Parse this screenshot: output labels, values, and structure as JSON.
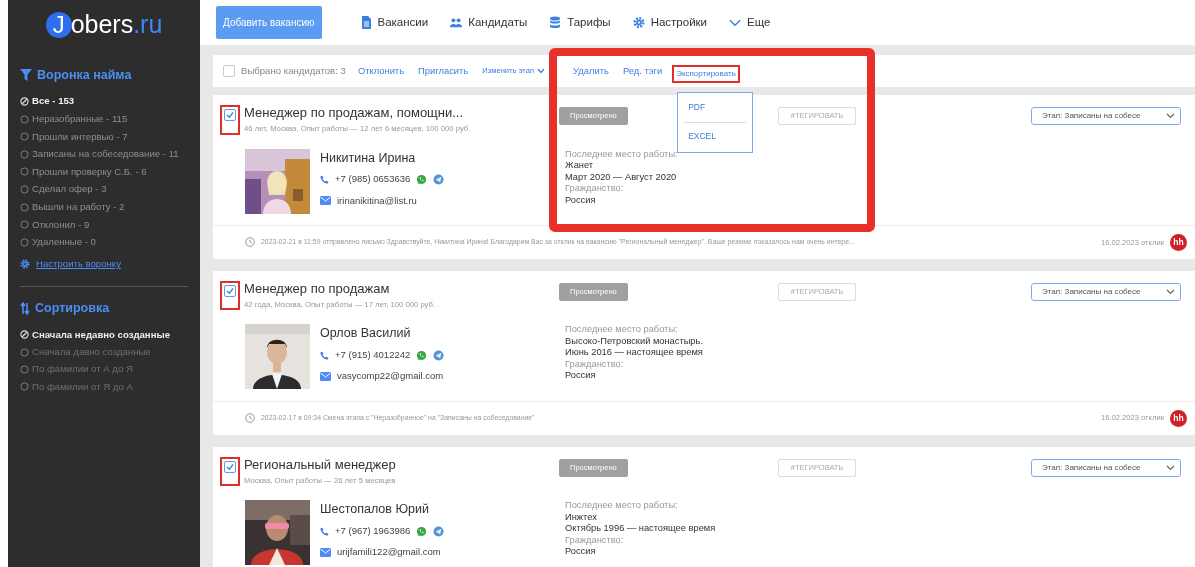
{
  "logo": {
    "letter": "J",
    "name": "obers",
    "domain": ".ru"
  },
  "sidebar": {
    "funnel": {
      "title": "Воронка найма",
      "items": [
        {
          "label": "Все - 153",
          "selected": true
        },
        {
          "label": "Неразобранные - 115",
          "selected": false
        },
        {
          "label": "Прошли интервью - 7",
          "selected": false
        },
        {
          "label": "Записаны на собеседование - 11",
          "selected": false
        },
        {
          "label": "Прошли проверку С.Б. - 6",
          "selected": false
        },
        {
          "label": "Сделал офер - 3",
          "selected": false
        },
        {
          "label": "Вышли на работу - 2",
          "selected": false
        },
        {
          "label": "Отклонил - 9",
          "selected": false
        },
        {
          "label": "Удаленные - 0",
          "selected": false
        }
      ],
      "settings_link": "Настроить воронку"
    },
    "sorting": {
      "title": "Сортировка",
      "items": [
        {
          "label": "Сначала недавно созданные",
          "selected": true
        },
        {
          "label": "Сначала давно созданные",
          "selected": false
        },
        {
          "label": "По фамилии от А до Я",
          "selected": false
        },
        {
          "label": "По фамилии от Я до А",
          "selected": false
        }
      ]
    }
  },
  "topbar": {
    "add_button": "Добавить вакансию",
    "nav": [
      "Вакансии",
      "Кандидаты",
      "Тарифы",
      "Настройки",
      "Еще"
    ]
  },
  "toolbar": {
    "checked": false,
    "count_text": "Выбрано кандидатов: 3",
    "actions": [
      {
        "label": "Отклонить",
        "kind": "link",
        "highlighted": false
      },
      {
        "label": "Пригласить",
        "kind": "link",
        "highlighted": false
      },
      {
        "label": "Изменить этап",
        "kind": "dropdown",
        "highlighted": false
      },
      {
        "label": "Удалить",
        "kind": "link",
        "highlighted": false
      },
      {
        "label": "Ред. тэги",
        "kind": "link",
        "highlighted": false
      },
      {
        "label": "Экспортировать",
        "kind": "link",
        "highlighted": true
      }
    ],
    "export_menu": [
      "PDF",
      "EXCEL"
    ]
  },
  "candidates": [
    {
      "checked": true,
      "highlighted": true,
      "title": "Менеджер по продажам, помощни...",
      "meta": "46 лет, Москва, Опыт работы — 12 лет 6 месяцев, 100 000 руб.",
      "status": "Просмотрено",
      "tag_button": "#ТЕГИРОВАТЬ",
      "stage": "Этап: Записаны на собесе",
      "name": "Никитина Ирина",
      "phone": "+7 (985) 0653636",
      "email": "irinanikitina@list.ru",
      "work_label": "Последнее место работы:",
      "company": "Жанет",
      "period": "Март 2020 — Август 2020",
      "citizenship_label": "Гражданство:",
      "country": "Россия",
      "log": "2023-02-21 в 11:59 отправлено письмо Здравствуйте, Никитина Ирина! Благодарим Вас за отклик на вакансию \"Региональный менеджер\". Ваше резюме показалось нам очень интере...",
      "date": "16.02.2023 отклик",
      "source": "hh"
    },
    {
      "checked": true,
      "highlighted": true,
      "title": "Менеджер по продажам",
      "meta": "42 года, Москва, Опыт работы — 17 лет, 100 000 руб.",
      "status": "Просмотрено",
      "tag_button": "#ТЕГИРОВАТЬ",
      "stage": "Этап: Записаны на собесе",
      "name": "Орлов Василий",
      "phone": "+7 (915) 4012242",
      "email": "vasycomp22@gmail.com",
      "work_label": "Последнее место работы:",
      "company": "Высоко-Петровский монастырь.",
      "period": "Июнь 2016 — настоящее время",
      "citizenship_label": "Гражданство:",
      "country": "Россия",
      "log": "2023-02-17 в 09:34 Смена этапа с \"Неразобранное\" на \"Записаны на собеседование\"",
      "date": "16.02.2023 отклик",
      "source": "hh"
    },
    {
      "checked": true,
      "highlighted": true,
      "title": "Региональный менеджер",
      "meta": "Москва, Опыт работы — 26 лет 5 месяцев",
      "status": "Просмотрено",
      "tag_button": "#ТЕГИРОВАТЬ",
      "stage": "Этап: Записаны на собесе",
      "name": "Шестопалов Юрий",
      "phone": "+7 (967) 1963986",
      "email": "urijfamili122@gmail.com",
      "work_label": "Последнее место работы:",
      "company": "Инжтех",
      "period": "Октябрь 1996 — настоящее время",
      "citizenship_label": "Гражданство:",
      "country": "Россия"
    }
  ]
}
